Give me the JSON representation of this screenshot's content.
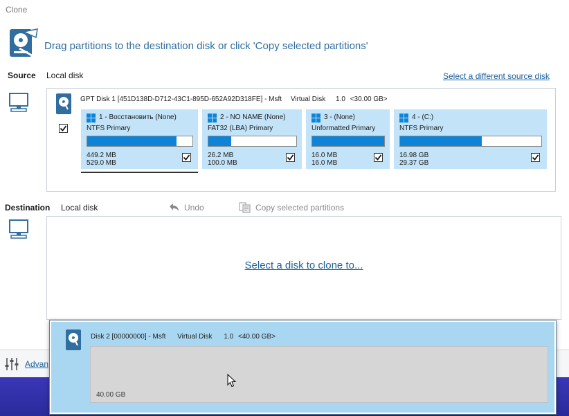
{
  "window": {
    "title": "Clone"
  },
  "header": {
    "instruction": "Drag partitions to the destination disk or click 'Copy selected partitions'"
  },
  "source": {
    "label": "Source",
    "value": "Local disk",
    "change_link": "Select a different source disk",
    "disk": {
      "name": "GPT Disk 1 [451D138D-D712-43C1-895D-652A92D318FE] - Msft",
      "type": "Virtual Disk",
      "version": "1.0",
      "size": "<30.00 GB>",
      "checked": true
    },
    "partitions": [
      {
        "title": "1 - Восстановить (None)",
        "fs": "NTFS Primary",
        "used": "449.2 MB",
        "total": "529.0 MB",
        "fill_percent": 85,
        "checked": true,
        "selected": true
      },
      {
        "title": "2 - NO NAME (None)",
        "fs": "FAT32 (LBA) Primary",
        "used": "26.2 MB",
        "total": "100.0 MB",
        "fill_percent": 26,
        "checked": true,
        "selected": false
      },
      {
        "title": "3 -  (None)",
        "fs": "Unformatted Primary",
        "used": "16.0 MB",
        "total": "16.0 MB",
        "fill_percent": 100,
        "checked": true,
        "selected": false
      },
      {
        "title": "4 -  (C:)",
        "fs": "NTFS Primary",
        "used": "16.98 GB",
        "total": "29.37 GB",
        "fill_percent": 58,
        "checked": true,
        "selected": false
      }
    ]
  },
  "destination": {
    "label": "Destination",
    "value": "Local disk",
    "undo_label": "Undo",
    "copy_label": "Copy selected partitions",
    "select_link": "Select a disk to clone to..."
  },
  "dropdown": {
    "disk": {
      "name": "Disk 2 [00000000] - Msft",
      "type": "Virtual Disk",
      "version": "1.0",
      "size": "<40.00 GB>"
    },
    "unallocated_size": "40.00 GB"
  },
  "bottom": {
    "advanced_label": "Advanced Options"
  },
  "colors": {
    "accent": "#0e84d8",
    "partition_bg": "#c3e3f8",
    "dropdown_row": "#a9d7f2",
    "link": "#1a5f9c",
    "taskbar": "#2b2a9a"
  }
}
